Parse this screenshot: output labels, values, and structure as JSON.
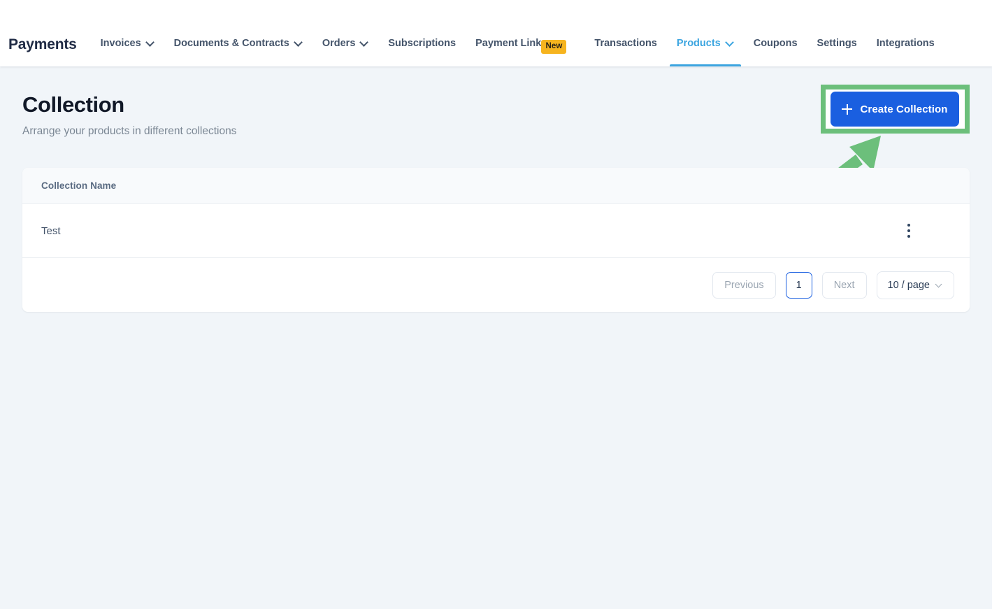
{
  "nav": {
    "brand": "Payments",
    "left_items": [
      {
        "label": "Invoices",
        "has_dropdown": true,
        "active": false,
        "badge": ""
      },
      {
        "label": "Documents & Contracts",
        "has_dropdown": true,
        "active": false,
        "badge": ""
      },
      {
        "label": "Orders",
        "has_dropdown": true,
        "active": false,
        "badge": ""
      },
      {
        "label": "Subscriptions",
        "has_dropdown": false,
        "active": false,
        "badge": ""
      },
      {
        "label": "Payment Links",
        "has_dropdown": false,
        "active": false,
        "badge": "New"
      }
    ],
    "right_items": [
      {
        "label": "Transactions",
        "has_dropdown": false,
        "active": false
      },
      {
        "label": "Products",
        "has_dropdown": true,
        "active": true
      },
      {
        "label": "Coupons",
        "has_dropdown": false,
        "active": false
      },
      {
        "label": "Settings",
        "has_dropdown": false,
        "active": false
      },
      {
        "label": "Integrations",
        "has_dropdown": false,
        "active": false
      }
    ],
    "active_color": "#3ca5e0",
    "badge_color": "#f6b41f"
  },
  "page": {
    "title": "Collection",
    "subtitle": "Arrange your products in different collections"
  },
  "cta": {
    "label": "Create Collection",
    "icon": "plus-icon",
    "button_color": "#1a5fe0",
    "highlight_color": "#6cbf7b"
  },
  "annotation": {
    "arrow_color": "#6cbf7b",
    "points_to": "Create Collection"
  },
  "table": {
    "columns": [
      "Collection Name"
    ],
    "rows": [
      {
        "name": "Test",
        "menu_icon": "kebab-menu-icon"
      }
    ]
  },
  "pagination": {
    "previous_label": "Previous",
    "next_label": "Next",
    "current_page": "1",
    "page_size_label": "10 / page",
    "previous_disabled": true,
    "next_disabled": true
  }
}
